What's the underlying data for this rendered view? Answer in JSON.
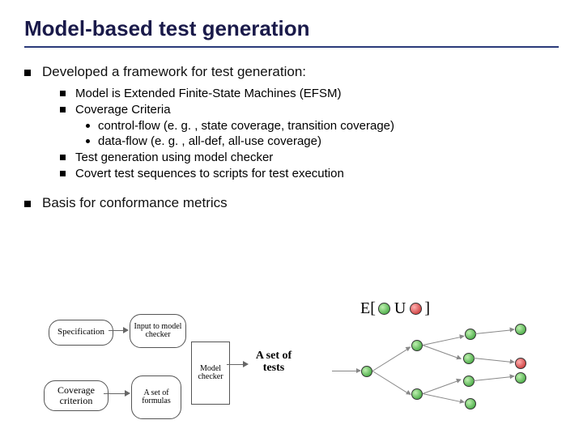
{
  "title": "Model-based test generation",
  "bullets": {
    "b1": "Developed a framework for test generation:",
    "b1_1": "Model is Extended Finite-State Machines (EFSM)",
    "b1_2": "Coverage Criteria",
    "b1_2_a": "control-flow (e. g. , state coverage, transition coverage)",
    "b1_2_b": "data-flow (e. g. , all-def, all-use coverage)",
    "b1_3": "Test generation using model checker",
    "b1_4": "Covert test sequences to scripts for test execution",
    "b2": "Basis for conformance metrics"
  },
  "flow": {
    "spec": "Specification",
    "input": "Input to model checker",
    "coverage": "Coverage criterion",
    "formulas": "A set of formulas",
    "checker": "Model checker",
    "tests": "A set of tests"
  },
  "formula": {
    "open": "E[",
    "mid": "U",
    "close": "]"
  }
}
